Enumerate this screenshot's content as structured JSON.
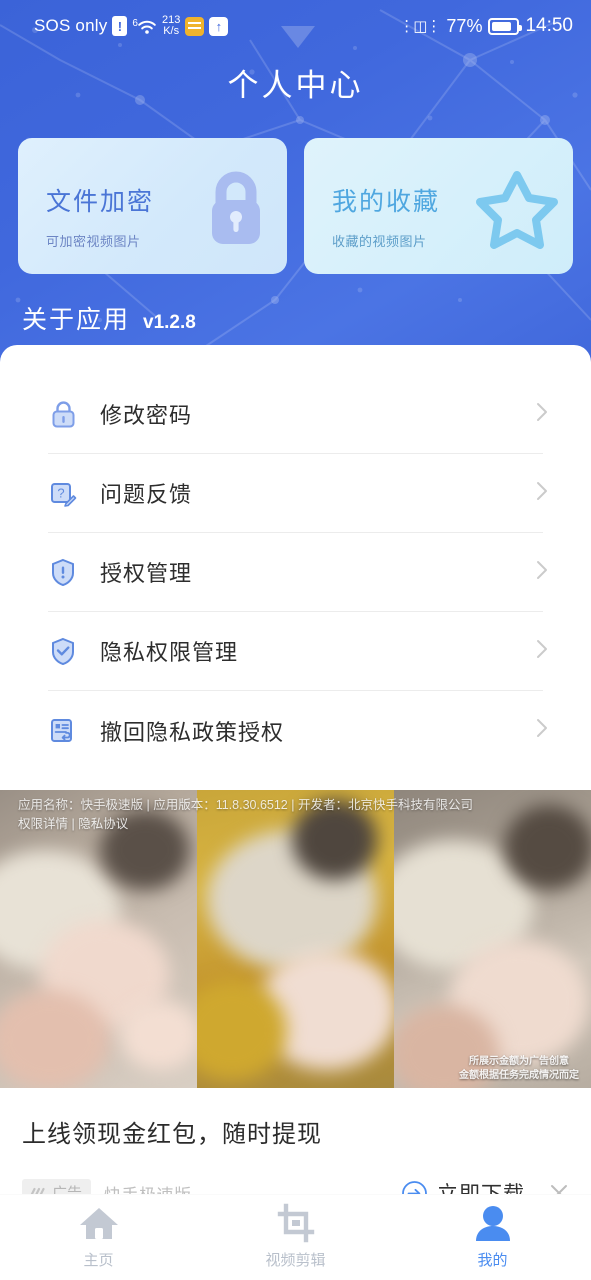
{
  "status_bar": {
    "carrier": "SOS only",
    "sim_alert_icon": "sim-alert-icon",
    "wifi_generation": "6",
    "wifi_icon": "wifi-icon",
    "net_speed_value": "213",
    "net_speed_unit": "K/s",
    "notification_icon": "calendar-icon",
    "upload_icon": "upload-arrow-icon",
    "vibrate_icon": "vibrate-icon",
    "battery_percent": "77%",
    "battery_icon": "battery-icon",
    "clock": "14:50"
  },
  "header": {
    "title": "个人中心",
    "accent": "#4068dd",
    "cards": [
      {
        "title": "文件加密",
        "subtitle": "可加密视频图片",
        "icon": "lock-icon",
        "title_color": "#4a75d6"
      },
      {
        "title": "我的收藏",
        "subtitle": "收藏的视频图片",
        "icon": "star-icon",
        "title_color": "#4fa7e0"
      }
    ],
    "about_title": "关于应用",
    "about_version": "v1.2.8"
  },
  "menu": {
    "items": [
      {
        "label": "修改密码",
        "icon": "lock-icon",
        "chevron": "chevron-right-icon"
      },
      {
        "label": "问题反馈",
        "icon": "feedback-pencil-icon",
        "chevron": "chevron-right-icon"
      },
      {
        "label": "授权管理",
        "icon": "shield-icon",
        "chevron": "chevron-right-icon"
      },
      {
        "label": "隐私权限管理",
        "icon": "shield-check-icon",
        "chevron": "chevron-right-icon"
      },
      {
        "label": "撤回隐私政策授权",
        "icon": "document-revoke-icon",
        "chevron": "chevron-right-icon"
      }
    ]
  },
  "ad": {
    "overlay_line1": "应用名称：快手极速版 | 应用版本：11.8.30.6512 | 开发者：北京快手科技有限公司",
    "overlay_line2_a": "权限详情",
    "overlay_sep": " | ",
    "overlay_line2_b": "隐私协议",
    "disclaimer_line1": "所展示金额为广告创意",
    "disclaimer_line2": "金额根据任务完成情况而定",
    "title": "上线领现金红包，随时提现",
    "tag_label": "广告",
    "tag_icon": "ad-waveform-icon",
    "brand": "快手极速版",
    "cta_label": "立即下载",
    "cta_icon": "arrow-right-circle-icon",
    "close_icon": "close-icon"
  },
  "bottom_nav": {
    "active_color": "#4a8cf0",
    "inactive_color": "#b9c0cb",
    "items": [
      {
        "label": "主页",
        "icon": "home-icon",
        "active": false
      },
      {
        "label": "视频剪辑",
        "icon": "crop-icon",
        "active": false
      },
      {
        "label": "我的",
        "icon": "person-icon",
        "active": true
      }
    ]
  }
}
